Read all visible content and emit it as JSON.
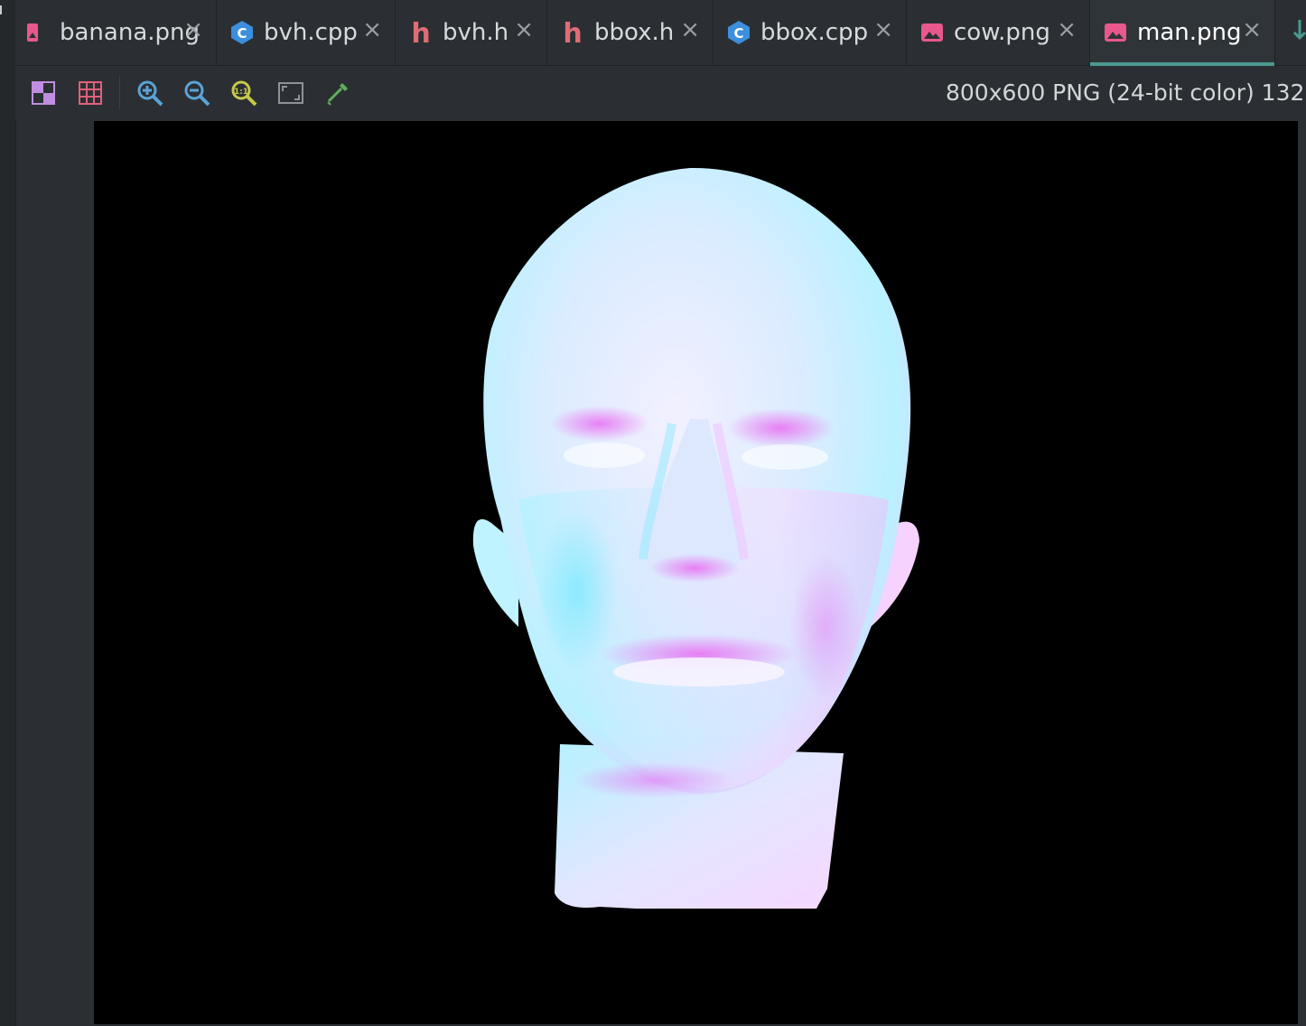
{
  "tabs": [
    {
      "label": "banana.png",
      "icon": "image-file-icon",
      "active": false
    },
    {
      "label": "bvh.cpp",
      "icon": "cpp-file-icon",
      "active": false
    },
    {
      "label": "bvh.h",
      "icon": "header-file-icon",
      "active": false
    },
    {
      "label": "bbox.h",
      "icon": "header-file-icon",
      "active": false
    },
    {
      "label": "bbox.cpp",
      "icon": "cpp-file-icon",
      "active": false
    },
    {
      "label": "cow.png",
      "icon": "image-file-icon",
      "active": false
    },
    {
      "label": "man.png",
      "icon": "image-file-icon",
      "active": true
    }
  ],
  "tab_close_glyph": "×",
  "toolbar": {
    "tools": [
      "chessboard-icon",
      "grid-icon",
      "zoom-in-icon",
      "zoom-out-icon",
      "actual-size-icon",
      "fit-to-window-icon",
      "color-picker-icon"
    ],
    "image_info": "800x600 PNG (24-bit color) 132."
  },
  "colors": {
    "background": "#2b2f33",
    "active_tab_underline": "#4a9a8f",
    "cpp_icon": "#3b8fdc",
    "header_icon": "#e06c75",
    "image_icon": "#e8588c",
    "canvas": "#000000"
  }
}
